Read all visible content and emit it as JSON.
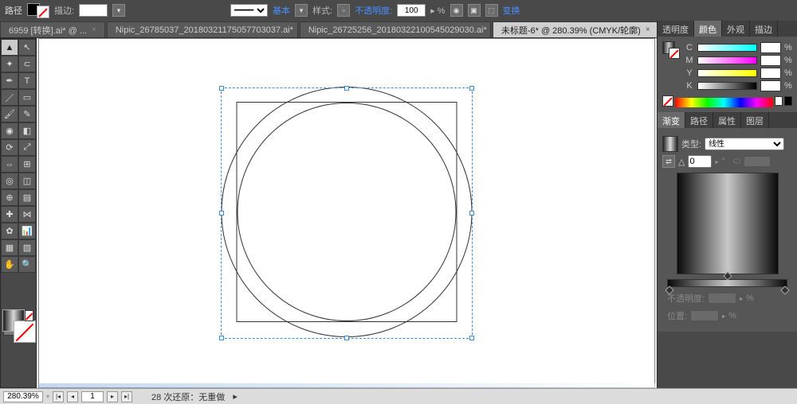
{
  "topbar": {
    "path_label": "路径",
    "stroke_label": "描边:",
    "stroke_pt": "",
    "style_basic": "基本",
    "style_label": "样式:",
    "opacity_label": "不透明度:",
    "opacity_value": "100",
    "transform_label": "变换"
  },
  "tabs": [
    {
      "label": "6959 [转换].ai* @ ...",
      "active": false
    },
    {
      "label": "Nipic_26785037_20180321175057703037.ai*",
      "active": false
    },
    {
      "label": "Nipic_26725256_20180322100545029030.ai*",
      "active": false
    },
    {
      "label": "未标题-6* @ 280.39% (CMYK/轮廓)",
      "active": true
    }
  ],
  "tools": [
    [
      "selection",
      "direct-selection"
    ],
    [
      "magic-wand",
      "lasso"
    ],
    [
      "pen",
      "type"
    ],
    [
      "line",
      "rectangle"
    ],
    [
      "brush",
      "pencil"
    ],
    [
      "blob-brush",
      "eraser"
    ],
    [
      "rotate",
      "scale"
    ],
    [
      "width",
      "free-transform"
    ],
    [
      "shape-builder",
      "perspective"
    ],
    [
      "mesh",
      "gradient"
    ],
    [
      "eyedropper",
      "blend"
    ],
    [
      "symbol-sprayer",
      "graph"
    ],
    [
      "artboard",
      "slice"
    ],
    [
      "hand",
      "zoom"
    ]
  ],
  "tool_glyphs": [
    [
      "▲",
      "↖"
    ],
    [
      "✦",
      "⊂"
    ],
    [
      "✒",
      "T"
    ],
    [
      "／",
      "▭"
    ],
    [
      "🖌",
      "✎"
    ],
    [
      "◉",
      "◧"
    ],
    [
      "⟳",
      "⤢"
    ],
    [
      "⇔",
      "⊞"
    ],
    [
      "◎",
      "◫"
    ],
    [
      "⊕",
      "▤"
    ],
    [
      "✚",
      "⋈"
    ],
    [
      "✿",
      "📊"
    ],
    [
      "▦",
      "▧"
    ],
    [
      "✋",
      "🔍"
    ]
  ],
  "color_panel": {
    "tabs": [
      "透明度",
      "颜色",
      "外观",
      "描边"
    ],
    "active_tab": 1,
    "channels": [
      {
        "k": "C",
        "v": ""
      },
      {
        "k": "M",
        "v": ""
      },
      {
        "k": "Y",
        "v": ""
      },
      {
        "k": "K",
        "v": ""
      }
    ],
    "pct": "%"
  },
  "grad_panel": {
    "tabs": [
      "渐变",
      "路径",
      "属性",
      "图层"
    ],
    "active_tab": 0,
    "type_label": "类型:",
    "type_value": "线性",
    "angle_label": "△",
    "angle_value": "0",
    "opacity_label": "不透明度:",
    "position_label": "位置:",
    "pct": "%"
  },
  "status": {
    "zoom": "280.39%",
    "page": "1",
    "undo_text": "28 次还原：无重做"
  }
}
